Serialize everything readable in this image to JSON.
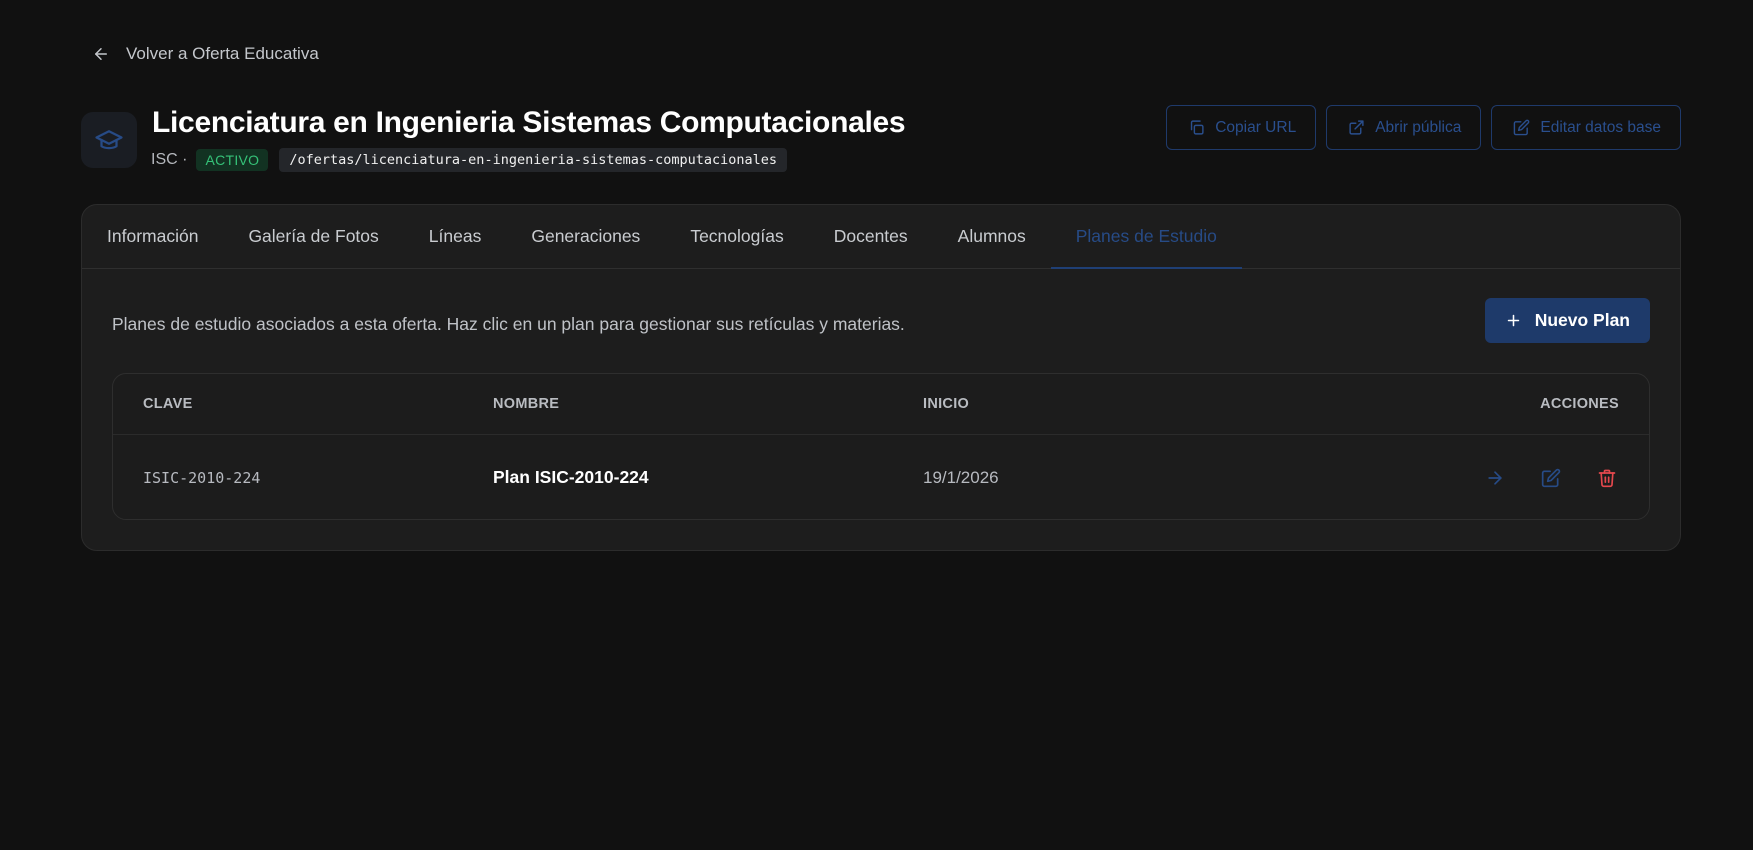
{
  "nav": {
    "back_label": "Volver a Oferta Educativa"
  },
  "header": {
    "title": "Licenciatura en Ingenieria Sistemas Computacionales",
    "code": "ISC ·",
    "status": "ACTIVO",
    "slug": "/ofertas/licenciatura-en-ingenieria-sistemas-computacionales",
    "icon": "graduation-cap-icon",
    "actions": {
      "copy_url": "Copiar URL",
      "open_public": "Abrir pública",
      "edit_base": "Editar datos base"
    }
  },
  "tabs": [
    {
      "label": "Información"
    },
    {
      "label": "Galería de Fotos"
    },
    {
      "label": "Líneas"
    },
    {
      "label": "Generaciones"
    },
    {
      "label": "Tecnologías"
    },
    {
      "label": "Docentes"
    },
    {
      "label": "Alumnos"
    },
    {
      "label": "Planes de Estudio",
      "active": true
    }
  ],
  "plans": {
    "intro": "Planes de estudio asociados a esta oferta. Haz clic en un plan para gestionar sus retículas y materias.",
    "new_button": "Nuevo Plan",
    "columns": {
      "key": "CLAVE",
      "name": "NOMBRE",
      "start": "INICIO",
      "actions": "ACCIONES"
    },
    "rows": [
      {
        "key": "ISIC-2010-224",
        "name": "Plan ISIC-2010-224",
        "start": "19/1/2026"
      }
    ]
  },
  "colors": {
    "accent": "#1e3a6a",
    "accent_text": "#274b86",
    "status_green": "#35c178",
    "danger": "#e5484d",
    "background": "#111111"
  }
}
